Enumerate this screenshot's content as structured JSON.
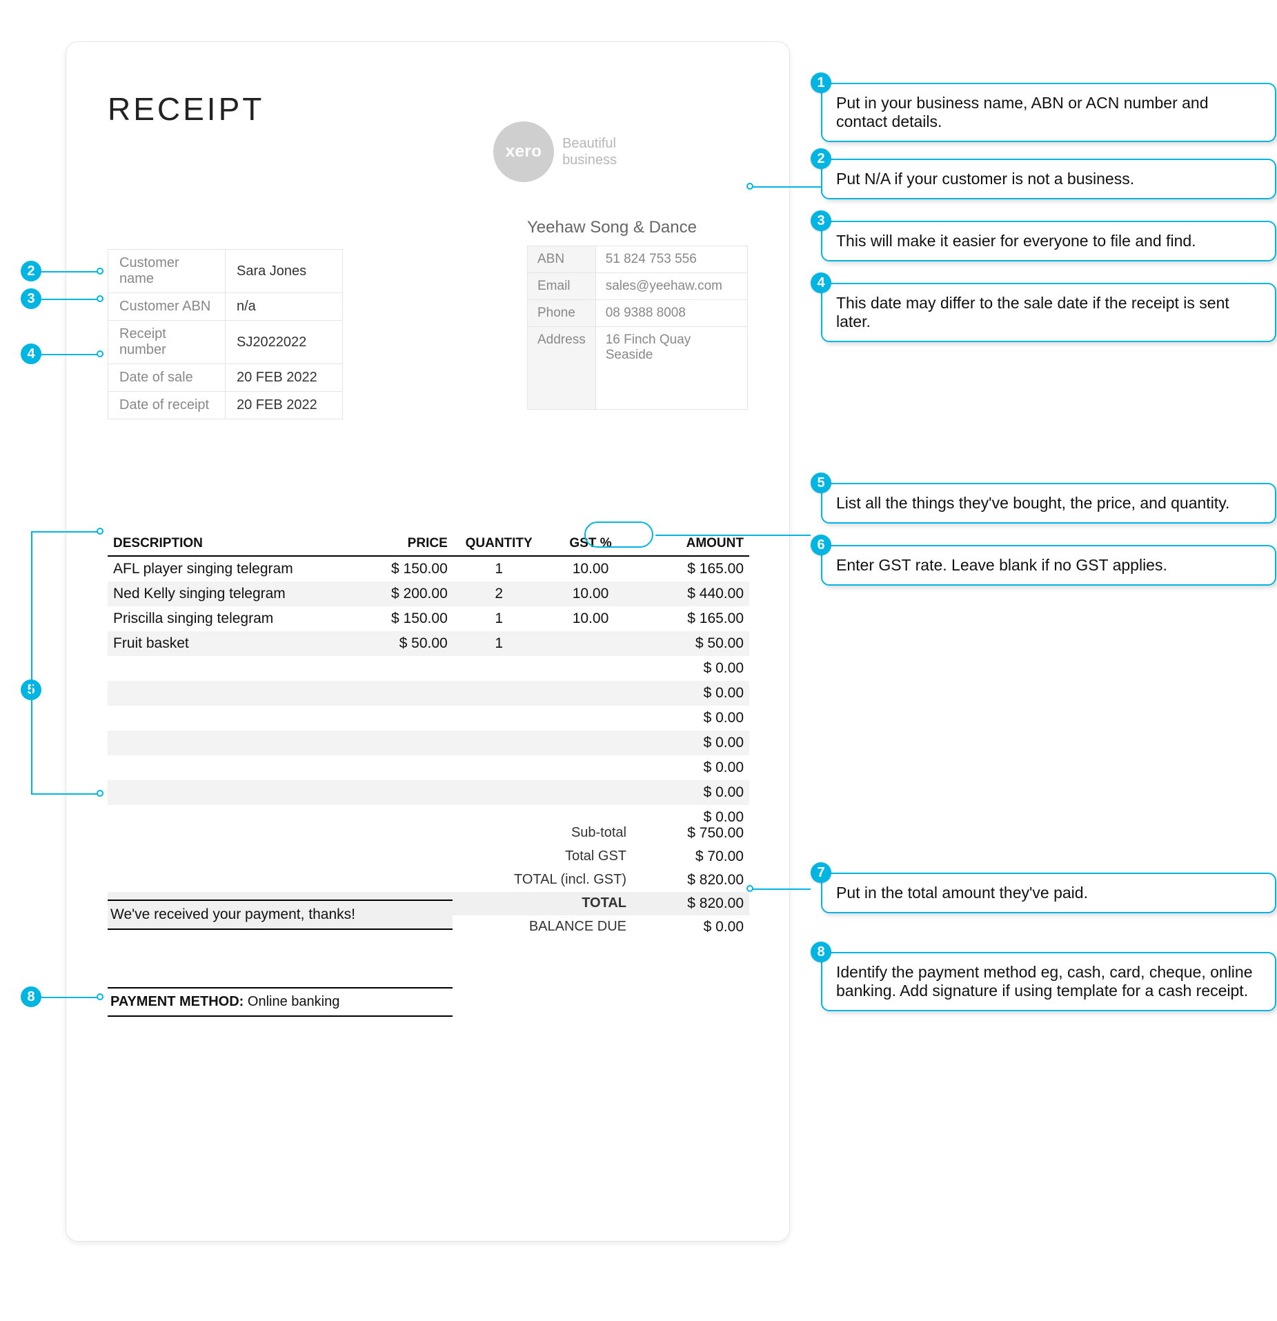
{
  "title": "RECEIPT",
  "logo": {
    "brand": "xero",
    "tagline1": "Beautiful",
    "tagline2": "business"
  },
  "customer": {
    "labels": {
      "name": "Customer name",
      "abn": "Customer ABN",
      "rnum": "Receipt number",
      "dsale": "Date of sale",
      "dreceipt": "Date of receipt"
    },
    "name": "Sara Jones",
    "abn": "n/a",
    "rnum": "SJ2022022",
    "dsale": "20 FEB 2022",
    "dreceipt": "20 FEB 2022"
  },
  "business": {
    "name": "Yeehaw Song & Dance",
    "labels": {
      "abn": "ABN",
      "email": "Email",
      "phone": "Phone",
      "address": "Address"
    },
    "abn": "51 824 753 556",
    "email": "sales@yeehaw.com",
    "phone": "08 9388 8008",
    "address1": "16 Finch Quay",
    "address2": "Seaside"
  },
  "columns": {
    "desc": "DESCRIPTION",
    "price": "PRICE",
    "qty": "QUANTITY",
    "gst": "GST %",
    "amt": "AMOUNT"
  },
  "items": [
    {
      "desc": "AFL player singing telegram",
      "price": "$ 150.00",
      "qty": "1",
      "gst": "10.00",
      "amt": "$ 165.00"
    },
    {
      "desc": "Ned Kelly singing telegram",
      "price": "$ 200.00",
      "qty": "2",
      "gst": "10.00",
      "amt": "$ 440.00"
    },
    {
      "desc": "Priscilla singing telegram",
      "price": "$ 150.00",
      "qty": "1",
      "gst": "10.00",
      "amt": "$ 165.00"
    },
    {
      "desc": "Fruit basket",
      "price": "$ 50.00",
      "qty": "1",
      "gst": "",
      "amt": "$ 50.00"
    },
    {
      "desc": "",
      "price": "",
      "qty": "",
      "gst": "",
      "amt": "$ 0.00"
    },
    {
      "desc": "",
      "price": "",
      "qty": "",
      "gst": "",
      "amt": "$ 0.00"
    },
    {
      "desc": "",
      "price": "",
      "qty": "",
      "gst": "",
      "amt": "$ 0.00"
    },
    {
      "desc": "",
      "price": "",
      "qty": "",
      "gst": "",
      "amt": "$ 0.00"
    },
    {
      "desc": "",
      "price": "",
      "qty": "",
      "gst": "",
      "amt": "$ 0.00"
    },
    {
      "desc": "",
      "price": "",
      "qty": "",
      "gst": "",
      "amt": "$ 0.00"
    },
    {
      "desc": "",
      "price": "",
      "qty": "",
      "gst": "",
      "amt": "$ 0.00"
    }
  ],
  "totals": {
    "subtotal_label": "Sub-total",
    "subtotal": "$ 750.00",
    "gst_label": "Total GST",
    "gst": "$ 70.00",
    "incl_label": "TOTAL (incl. GST)",
    "incl": "$ 820.00",
    "total_label": "TOTAL",
    "total": "$ 820.00",
    "balance_label": "BALANCE DUE",
    "balance": "$ 0.00"
  },
  "thanks": "We've received your payment, thanks!",
  "payment": {
    "label": "PAYMENT METHOD:",
    "value": "Online banking"
  },
  "annotations": {
    "n1": "Put in your business name, ABN or ACN number and contact details.",
    "n2": "Put N/A if your customer is not a business.",
    "n3": "This will make it easier for everyone to file and find.",
    "n4": "This date may differ to the sale date if the receipt is sent later.",
    "n5": "List all the things they've bought, the price, and quantity.",
    "n6": "Enter GST rate. Leave blank if no GST applies.",
    "n7": "Put in the total amount they've paid.",
    "n8": "Identify the payment method eg, cash, card, cheque, online banking. Add signature if using template for a cash receipt."
  },
  "badge_nums": {
    "b1": "1",
    "b2": "2",
    "b3": "3",
    "b4": "4",
    "b5": "5",
    "b6": "6",
    "b7": "7",
    "b8": "8"
  }
}
